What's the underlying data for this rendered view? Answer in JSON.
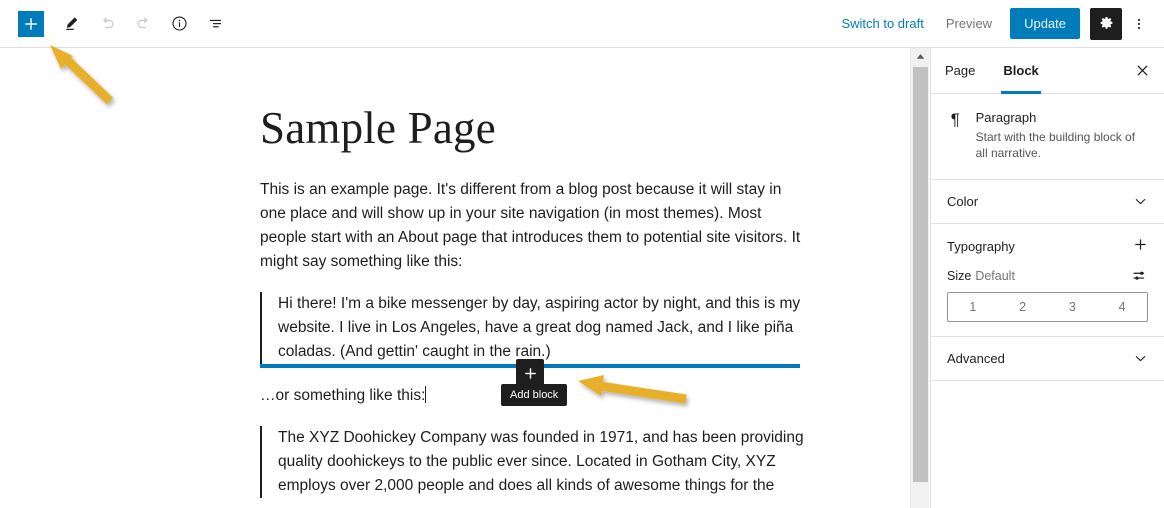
{
  "toolbar": {
    "add_block_label": "+",
    "icons": [
      "add-block-icon",
      "edit-pencil-icon",
      "undo-icon",
      "redo-icon",
      "info-icon",
      "list-view-icon"
    ],
    "switch_to_draft": "Switch to draft",
    "preview": "Preview",
    "update": "Update",
    "settings_icon": "gear-icon",
    "more_menu_icon": "more-options-icon"
  },
  "editor": {
    "title": "Sample Page",
    "paragraph_1": "This is an example page. It's different from a blog post because it will stay in one place and will show up in your site navigation (in most themes). Most people start with an About page that introduces them to potential site visitors. It might say something like this:",
    "quote_1": "Hi there! I'm a bike messenger by day, aspiring actor by night, and this is my website. I live in Los Angeles, have a great dog named Jack, and I like piña coladas. (And gettin' caught in the rain.)",
    "paragraph_2": "…or something like this:",
    "quote_2": "The XYZ Doohickey Company was founded in 1971, and has been providing quality doohickeys to the public ever since. Located in Gotham City, XYZ employs over 2,000 people and does all kinds of awesome things for the",
    "inserter_plus": "+",
    "inserter_tooltip": "Add block"
  },
  "sidebar": {
    "tabs": [
      {
        "label": "Page",
        "active": false
      },
      {
        "label": "Block",
        "active": true
      }
    ],
    "close_icon": "close-icon",
    "block": {
      "icon": "paragraph-icon",
      "icon_glyph": "¶",
      "name": "Paragraph",
      "description": "Start with the building block of all narrative."
    },
    "panels": [
      {
        "label": "Color",
        "icon": "chevron-down-icon"
      },
      {
        "label": "Advanced",
        "icon": "chevron-down-icon"
      }
    ],
    "typography": {
      "label": "Typography",
      "add_icon": "plus-icon",
      "size_label": "Size",
      "size_value": "Default",
      "settings_icon": "sliders-icon",
      "size_options": [
        "1",
        "2",
        "3",
        "4"
      ]
    }
  },
  "colors": {
    "accent": "#007cba",
    "dark": "#1e1e1e",
    "arrow": "#e8b02b",
    "border": "#e0e0e0"
  },
  "annotations": [
    {
      "name": "arrow-to-toolbar-inserter",
      "color": "#e8b02b"
    },
    {
      "name": "arrow-to-add-block-inserter",
      "color": "#e8b02b"
    }
  ]
}
